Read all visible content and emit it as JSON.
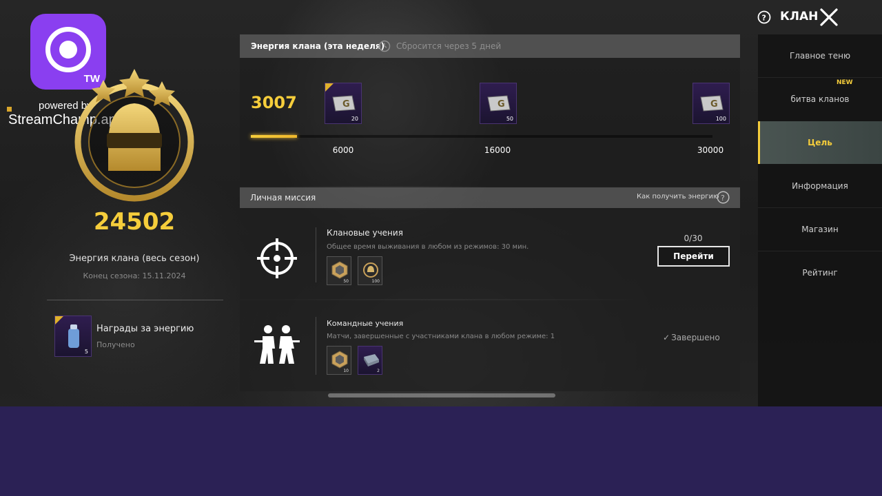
{
  "overlay": {
    "tw_label": "TW",
    "powered_by": "powered by",
    "app_name": "StreamChamp.app"
  },
  "header": {
    "clan_label": "КЛАН",
    "help_icon": "question-circle-icon",
    "close_icon": "close-x-icon"
  },
  "left_panel": {
    "clan_energy_total": "24502",
    "season_label": "Энергия клана (весь сезон)",
    "season_end": "Конец сезона: 15.11.2024",
    "energy_reward": {
      "title": "Награды за энергию",
      "status": "Получено",
      "count": "5",
      "icon": "spray-can-icon"
    }
  },
  "weekly": {
    "title": "Энергия клана (эта неделя)",
    "reset_text": "Сбросится через 5 дней",
    "current_value": "3007",
    "progress_fraction": 0.1,
    "milestones": [
      {
        "label": "6000",
        "reward_count": "20"
      },
      {
        "label": "16000",
        "reward_count": "50"
      },
      {
        "label": "30000",
        "reward_count": "100"
      }
    ]
  },
  "missions": {
    "section_title": "Личная миссия",
    "how_to_get": "Как получить энергию",
    "items": [
      {
        "title": "Клановые учения",
        "description": "Общее время выживания в любом из режимов: 30 мин.",
        "rewards": [
          "50",
          "100"
        ],
        "progress": "0/30",
        "action_label": "Перейти",
        "icon": "crosshair-icon"
      },
      {
        "title": "Командные учения",
        "description": "Матчи, завершенные с участниками клана в любом режиме: 1",
        "rewards": [
          "10",
          "2"
        ],
        "status": "Завершено",
        "icon": "team-soldiers-icon"
      }
    ]
  },
  "nav": {
    "items": [
      {
        "label": "Главное теню"
      },
      {
        "label": "битва кланов",
        "badge": "NEW"
      },
      {
        "label": "Цель",
        "active": true
      },
      {
        "label": "Информация"
      },
      {
        "label": "Магазин"
      },
      {
        "label": "Рейтинг"
      }
    ]
  },
  "colors": {
    "accent_gold": "#f5cd3b",
    "stream_purple": "#8a3ff0",
    "bottom_band": "#2b2155"
  }
}
